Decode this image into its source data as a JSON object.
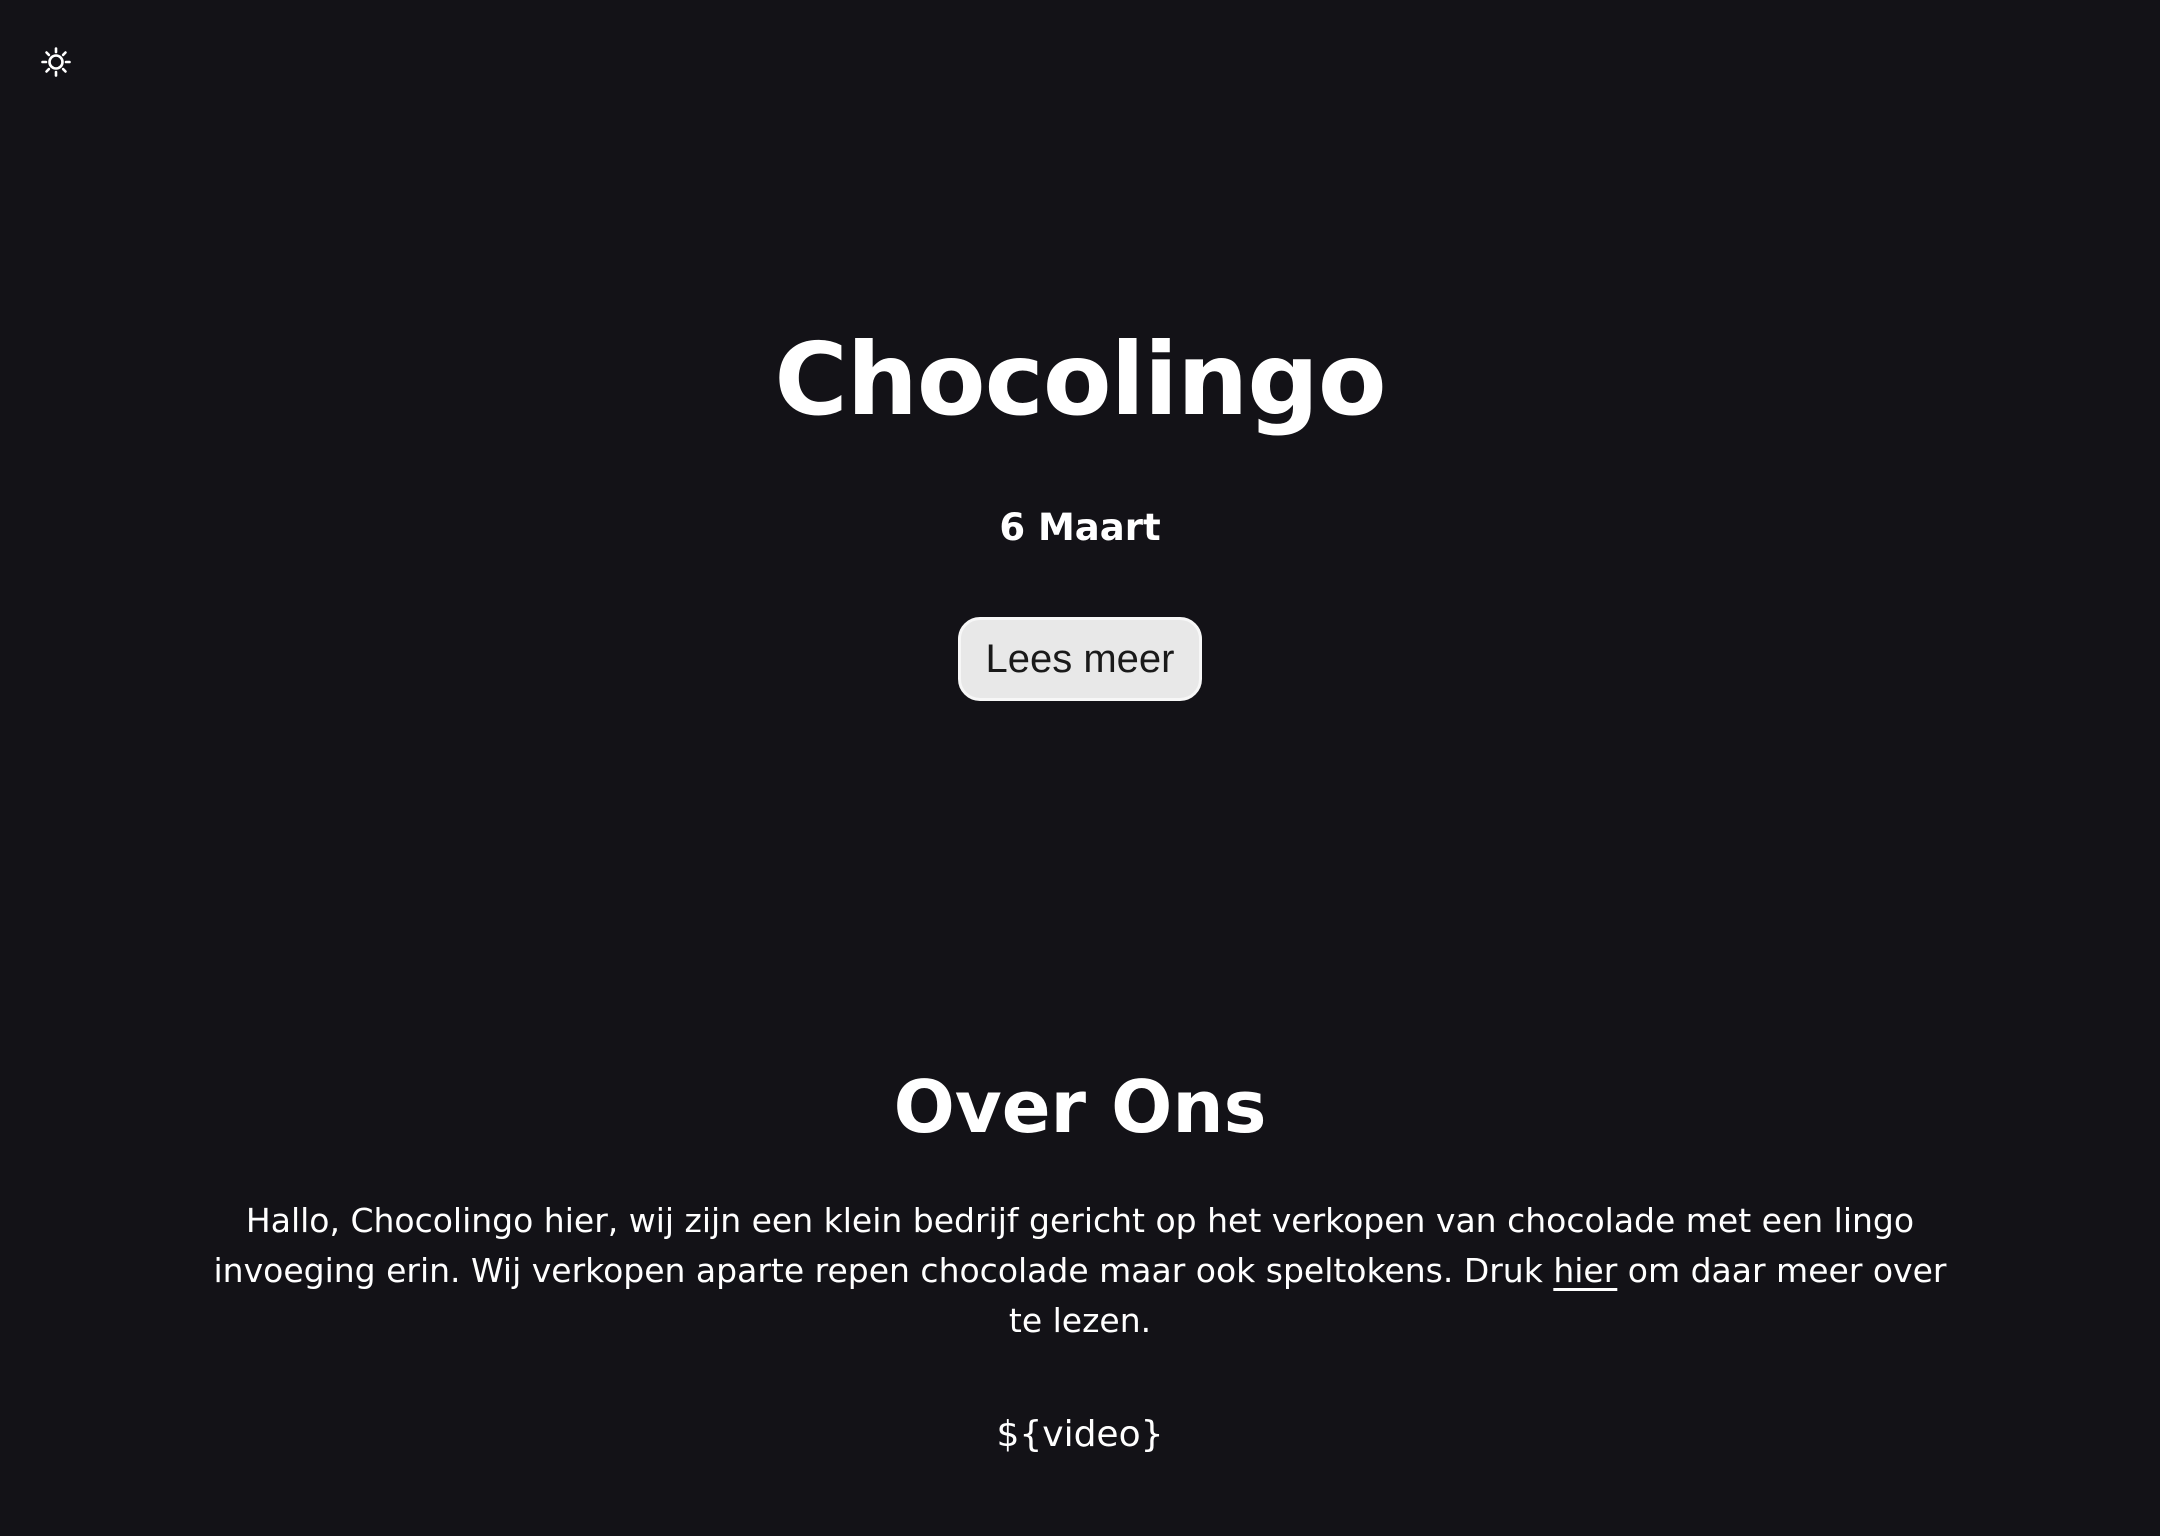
{
  "header": {
    "theme_toggle_icon": "sun-icon"
  },
  "hero": {
    "title": "Chocolingo",
    "date": "6 Maart",
    "button_label": "Lees meer"
  },
  "about": {
    "heading": "Over Ons",
    "text_before_link": "Hallo, Chocolingo hier, wij zijn een klein bedrijf gericht op het verkopen van chocolade met een lingo invoeging erin. Wij verkopen aparte repen chocolade maar ook speltokens. Druk ",
    "link_text": "hier",
    "text_after_link": " om daar meer over te lezen.",
    "video_placeholder": "${video}"
  },
  "colors": {
    "background": "#131217",
    "text": "#ffffff",
    "button_background": "#e8e8e8",
    "button_text": "#1a1a1a"
  }
}
